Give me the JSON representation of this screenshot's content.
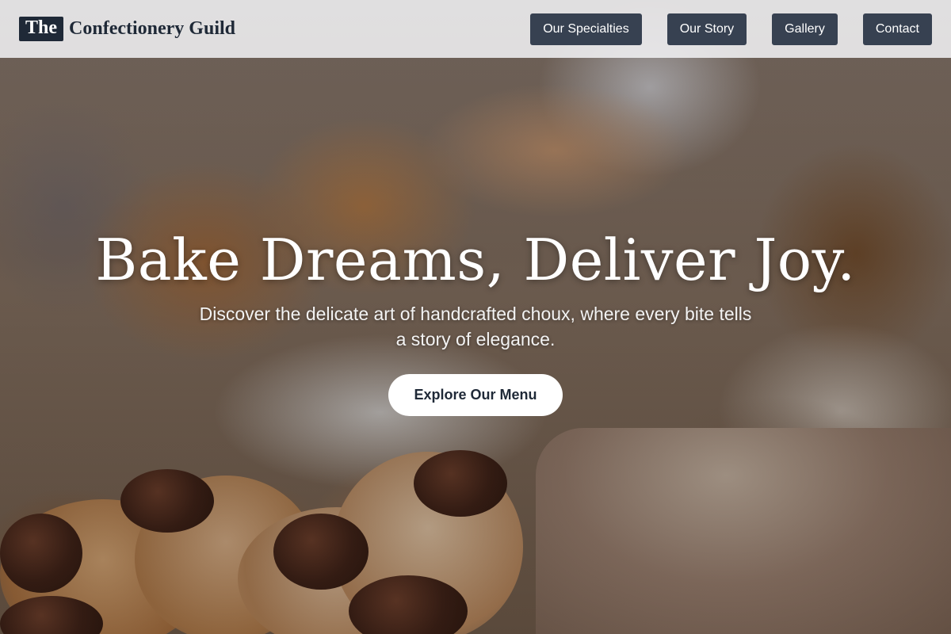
{
  "brand": {
    "mark": "The",
    "name": "Confectionery Guild"
  },
  "nav": {
    "items": [
      {
        "label": "Our Specialties"
      },
      {
        "label": "Our Story"
      },
      {
        "label": "Gallery"
      },
      {
        "label": "Contact"
      }
    ]
  },
  "hero": {
    "headline": "Bake Dreams, Deliver Joy.",
    "subheadline": "Discover the delicate art of handcrafted choux, where every bite tells a story of elegance.",
    "cta_label": "Explore Our Menu"
  },
  "colors": {
    "header_bg": "#f0f0f2",
    "nav_button_bg": "#374151",
    "brand_text": "#1f2937",
    "cta_bg": "#ffffff"
  }
}
